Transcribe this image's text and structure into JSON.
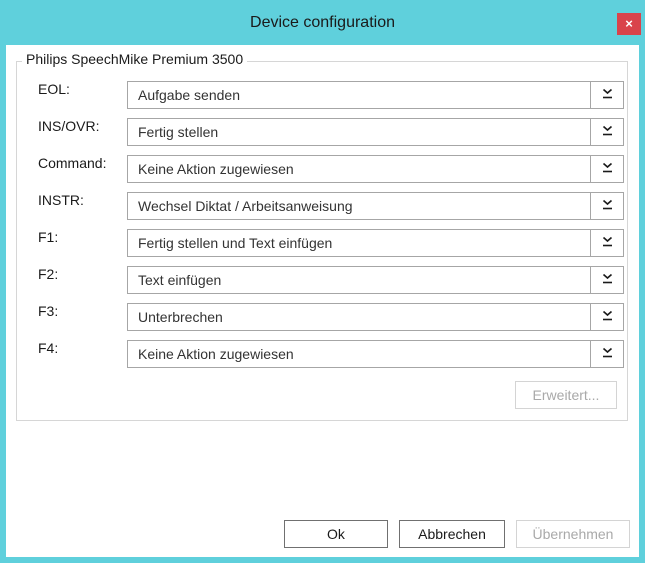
{
  "window": {
    "title": "Device configuration",
    "close_label": "×"
  },
  "group": {
    "legend": "Philips SpeechMike Premium 3500"
  },
  "rows": [
    {
      "label": "EOL:",
      "value": "Aufgabe senden"
    },
    {
      "label": "INS/OVR:",
      "value": "Fertig stellen"
    },
    {
      "label": "Command:",
      "value": "Keine Aktion zugewiesen"
    },
    {
      "label": "INSTR:",
      "value": "Wechsel Diktat / Arbeitsanweisung"
    },
    {
      "label": "F1:",
      "value": "Fertig stellen und Text einfügen"
    },
    {
      "label": "F2:",
      "value": "Text einfügen"
    },
    {
      "label": "F3:",
      "value": "Unterbrechen"
    },
    {
      "label": "F4:",
      "value": "Keine Aktion zugewiesen"
    }
  ],
  "buttons": {
    "advanced": "Erweitert...",
    "ok": "Ok",
    "cancel": "Abbrechen",
    "apply": "Übernehmen"
  },
  "colors": {
    "chrome": "#5fd0dc",
    "close": "#d9434b"
  },
  "icons": {
    "close": "close-icon",
    "dropdown": "chevron-down-icon"
  }
}
